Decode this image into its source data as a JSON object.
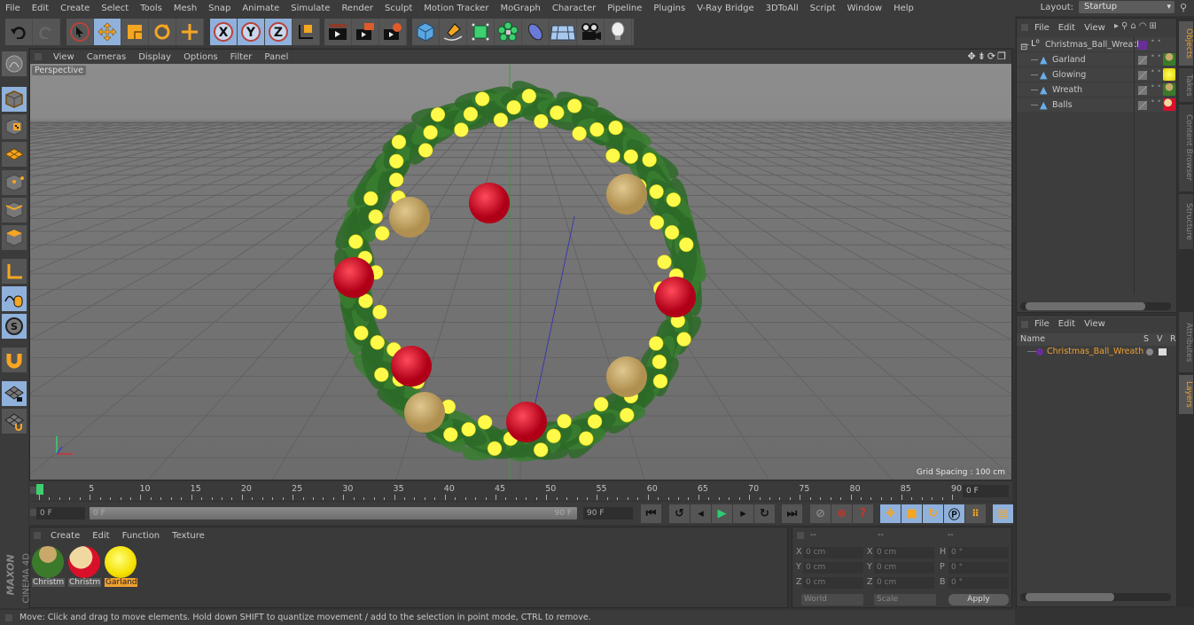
{
  "menu": [
    "File",
    "Edit",
    "Create",
    "Select",
    "Tools",
    "Mesh",
    "Snap",
    "Animate",
    "Simulate",
    "Render",
    "Sculpt",
    "Motion Tracker",
    "MoGraph",
    "Character",
    "Pipeline",
    "Plugins",
    "V-Ray Bridge",
    "3DToAll",
    "Script",
    "Window",
    "Help"
  ],
  "layout": {
    "label": "Layout:",
    "value": "Startup"
  },
  "toolbar": {
    "icons": [
      "undo-icon",
      "redo-icon",
      "live-selection-icon",
      "move-icon",
      "scale-icon",
      "rotate-icon",
      "add-move-icon",
      "x-axis-lock-icon",
      "y-axis-lock-icon",
      "z-axis-lock-icon",
      "coordinate-system-icon",
      "render-view-icon",
      "render-picture-viewer-icon",
      "render-settings-icon",
      "cube-primitive-icon",
      "pen-spline-icon",
      "subdivision-icon",
      "cloner-icon",
      "deformer-icon",
      "floor-icon",
      "camera-icon",
      "light-icon"
    ]
  },
  "left_tools": [
    "make-editable-icon",
    "model-mode-icon",
    "texture-mode-icon",
    "workplane-mode-icon",
    "points-mode-icon",
    "edges-mode-icon",
    "polygons-mode-icon",
    "axis-icon",
    "tweak-mode-icon",
    "solo-icon",
    "snap-magnet-icon",
    "workplane-lock-icon",
    "workplane-snap-icon"
  ],
  "viewport": {
    "menu": [
      "View",
      "Cameras",
      "Display",
      "Options",
      "Filter",
      "Panel"
    ],
    "camera": "Perspective",
    "grid_spacing": "Grid Spacing : 100 cm",
    "colors": {
      "red_ball": "#d8102a",
      "gold_ball": "#c9a86a",
      "light": "#fffa4a",
      "foliage": "#2e6e2a"
    }
  },
  "timeline": {
    "ticks": [
      "0",
      "5",
      "10",
      "15",
      "20",
      "25",
      "30",
      "35",
      "40",
      "45",
      "50",
      "55",
      "60",
      "65",
      "70",
      "75",
      "80",
      "85",
      "90"
    ],
    "current_frame": "0 F",
    "start_field": "0 F",
    "range_start": "0 F",
    "range_end": "90 F",
    "end_field": "90 F"
  },
  "materials": {
    "menu": [
      "Create",
      "Edit",
      "Function",
      "Texture"
    ],
    "items": [
      {
        "name": "Christm",
        "selected": false
      },
      {
        "name": "Christm",
        "selected": false
      },
      {
        "name": "Garland",
        "selected": true
      }
    ]
  },
  "coordinates": {
    "headers": [
      "--",
      "--",
      "--"
    ],
    "rows": [
      {
        "a": "X",
        "av": "0 cm",
        "b": "X",
        "bv": "0 cm",
        "c": "H",
        "cv": "0 °"
      },
      {
        "a": "Y",
        "av": "0 cm",
        "b": "Y",
        "bv": "0 cm",
        "c": "P",
        "cv": "0 °"
      },
      {
        "a": "Z",
        "av": "0 cm",
        "b": "Z",
        "bv": "0 cm",
        "c": "B",
        "cv": "0 °"
      }
    ],
    "space": "World",
    "mode": "Scale",
    "apply": "Apply"
  },
  "objects": {
    "menu": [
      "File",
      "Edit",
      "View"
    ],
    "items": [
      {
        "name": "Christmas_Ball_Wreath",
        "type": "null",
        "depth": 0
      },
      {
        "name": "Garland",
        "type": "object",
        "depth": 1
      },
      {
        "name": "Glowing",
        "type": "object",
        "depth": 1
      },
      {
        "name": "Wreath",
        "type": "object",
        "depth": 1
      },
      {
        "name": "Balls",
        "type": "object",
        "depth": 1
      }
    ]
  },
  "layers": {
    "menu": [
      "File",
      "Edit",
      "View"
    ],
    "columns": [
      "Name",
      "S",
      "V",
      "R"
    ],
    "items": [
      {
        "name": "Christmas_Ball_Wreath",
        "color": "#6a2e9a"
      }
    ]
  },
  "side_tabs": {
    "top": [
      {
        "label": "Objects",
        "active": true
      },
      {
        "label": "Takes",
        "active": false
      },
      {
        "label": "Content Browser",
        "active": false
      },
      {
        "label": "Structure",
        "active": false
      }
    ],
    "bottom": [
      {
        "label": "Attributes",
        "active": false
      },
      {
        "label": "Layers",
        "active": true
      }
    ]
  },
  "status": "Move: Click and drag to move elements. Hold down SHIFT to quantize movement / add to the selection in point mode, CTRL to remove.",
  "brand": {
    "maxon": "MAXON",
    "product": "CINEMA 4D"
  }
}
